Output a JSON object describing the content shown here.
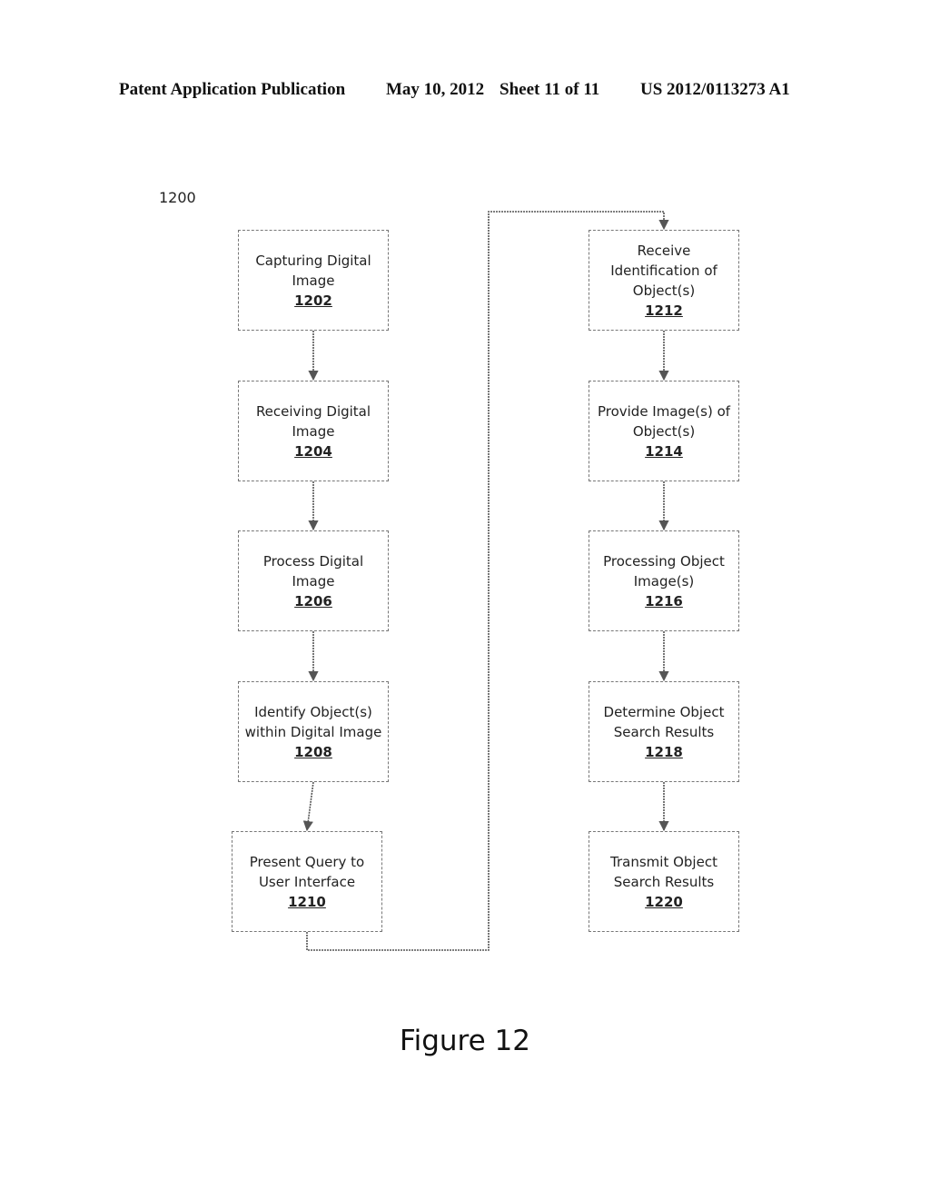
{
  "header": {
    "publication": "Patent Application Publication",
    "date": "May 10, 2012",
    "sheet": "Sheet 11 of 11",
    "patent_number": "US 2012/0113273 A1"
  },
  "diagram": {
    "reference": "1200",
    "steps": [
      {
        "label": "Capturing Digital\nImage",
        "number": "1202"
      },
      {
        "label": "Receiving Digital\nImage",
        "number": "1204"
      },
      {
        "label": "Process Digital\nImage",
        "number": "1206"
      },
      {
        "label": "Identify Object(s)\nwithin Digital Image",
        "number": "1208"
      },
      {
        "label": "Present Query to\nUser Interface",
        "number": "1210"
      },
      {
        "label": "Receive\nIdentification of\nObject(s)",
        "number": "1212"
      },
      {
        "label": "Provide Image(s) of\nObject(s)",
        "number": "1214"
      },
      {
        "label": "Processing Object\nImage(s)",
        "number": "1216"
      },
      {
        "label": "Determine Object\nSearch Results",
        "number": "1218"
      },
      {
        "label": "Transmit Object\nSearch Results",
        "number": "1220"
      }
    ],
    "flow": [
      [
        "1202",
        "1204"
      ],
      [
        "1204",
        "1206"
      ],
      [
        "1206",
        "1208"
      ],
      [
        "1208",
        "1210"
      ],
      [
        "1210",
        "1212"
      ],
      [
        "1212",
        "1214"
      ],
      [
        "1214",
        "1216"
      ],
      [
        "1216",
        "1218"
      ],
      [
        "1218",
        "1220"
      ]
    ]
  },
  "caption": "Figure 12"
}
